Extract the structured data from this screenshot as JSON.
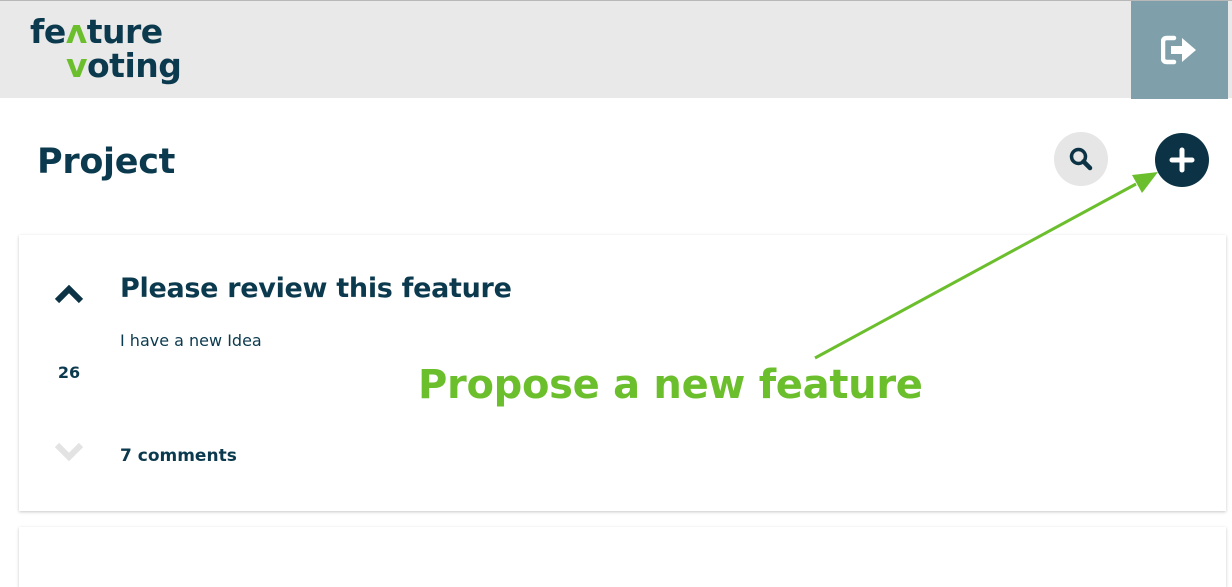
{
  "header": {
    "logo": {
      "line1_before": "fe",
      "line1_mark": "ʌ",
      "line1_after": "ture",
      "line2_mark": "v",
      "line2_after": "oting"
    },
    "logout_icon": "sign-out-icon"
  },
  "page": {
    "title": "Project",
    "search_icon": "search-icon",
    "add_icon": "plus-icon"
  },
  "features": [
    {
      "title": "Please review this feature",
      "description": "I have a new Idea",
      "votes": "26",
      "comments": "7 comments"
    }
  ],
  "annotation": {
    "text": "Propose a new feature",
    "color": "#6cbf2c"
  },
  "colors": {
    "brand_dark": "#0b3a4e",
    "brand_green": "#6cbf2c",
    "logout_bg": "#7f9faa"
  }
}
